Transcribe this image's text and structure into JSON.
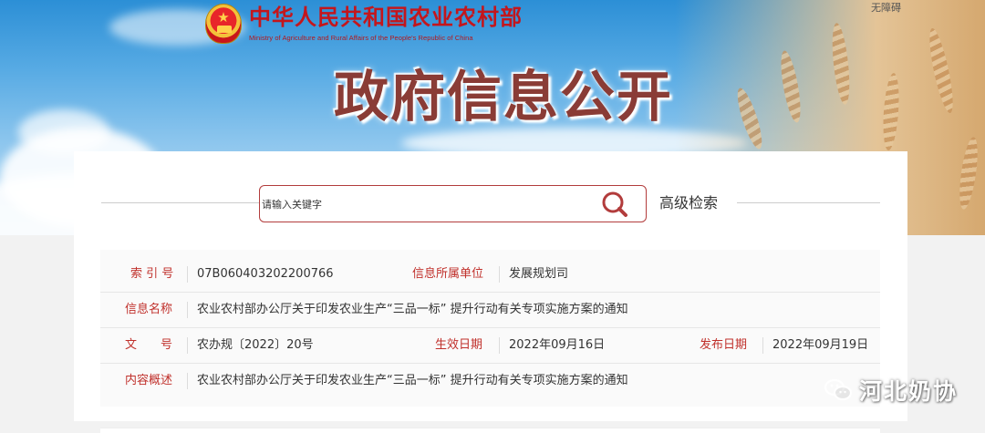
{
  "header": {
    "ministry_name_cn": "中华人民共和国农业农村部",
    "ministry_name_en": "Ministry of Agriculture and Rural Affairs of the People's Republic of China",
    "accessibility_link": "无障碍",
    "banner_title": "政府信息公开"
  },
  "search": {
    "placeholder": "请输入关键字",
    "advanced_label": "高级检索"
  },
  "info": {
    "index_label": "索 引 号",
    "index_value": "07B060403202200766",
    "dept_label": "信息所属单位",
    "dept_value": "发展规划司",
    "name_label": "信息名称",
    "name_value": "农业农村部办公厅关于印发农业生产“三品一标” 提升行动有关专项实施方案的通知",
    "docno_label": "文　　号",
    "docno_value": "农办规〔2022〕20号",
    "effective_label": "生效日期",
    "effective_value": "2022年09月16日",
    "publish_label": "发布日期",
    "publish_value": "2022年09月19日",
    "summary_label": "内容概述",
    "summary_value": "农业农村部办公厅关于印发农业生产“三品一标” 提升行动有关专项实施方案的通知"
  },
  "watermark": {
    "text": "河北奶协",
    "icon": "wechat-icon"
  },
  "colors": {
    "label_red": "#c0302b",
    "search_border": "#b23c3c",
    "ministry_red": "#c4161c"
  }
}
